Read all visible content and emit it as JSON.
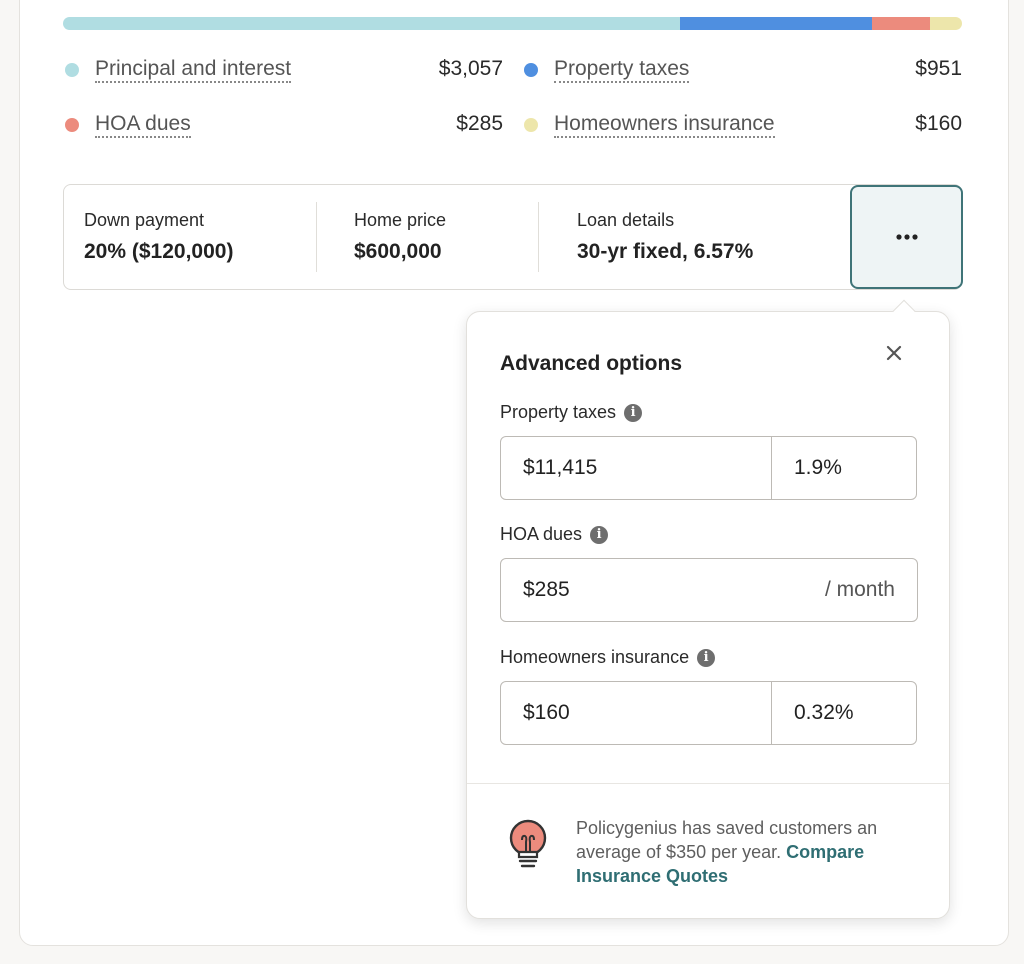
{
  "colors": {
    "principal": "#b0dde2",
    "taxes": "#4f8fe0",
    "hoa": "#ec8b7d",
    "insurance": "#ede6ab",
    "accent": "#2f6e73"
  },
  "breakdown": {
    "items": [
      {
        "label": "Principal and interest",
        "value": "$3,057",
        "amount": 3057
      },
      {
        "label": "Property taxes",
        "value": "$951",
        "amount": 951
      },
      {
        "label": "HOA dues",
        "value": "$285",
        "amount": 285
      },
      {
        "label": "Homeowners insurance",
        "value": "$160",
        "amount": 160
      }
    ]
  },
  "summary": {
    "down_payment_label": "Down payment",
    "down_payment_value": "20% ($120,000)",
    "home_price_label": "Home price",
    "home_price_value": "$600,000",
    "loan_label": "Loan details",
    "loan_value": "30-yr fixed, 6.57%",
    "more_button_icon": "more-horizontal-icon"
  },
  "advanced": {
    "title": "Advanced options",
    "close_icon": "close-icon",
    "property_taxes": {
      "label": "Property taxes",
      "amount": "$11,415",
      "percent": "1.9%"
    },
    "hoa_dues": {
      "label": "HOA dues",
      "amount": "$285",
      "suffix": "/ month"
    },
    "homeowners_insurance": {
      "label": "Homeowners insurance",
      "amount": "$160",
      "percent": "0.32%"
    },
    "promo": {
      "text": "Policygenius has saved customers an average of $350 per year.",
      "link": "Compare Insurance Quotes",
      "icon": "lightbulb-icon"
    }
  }
}
